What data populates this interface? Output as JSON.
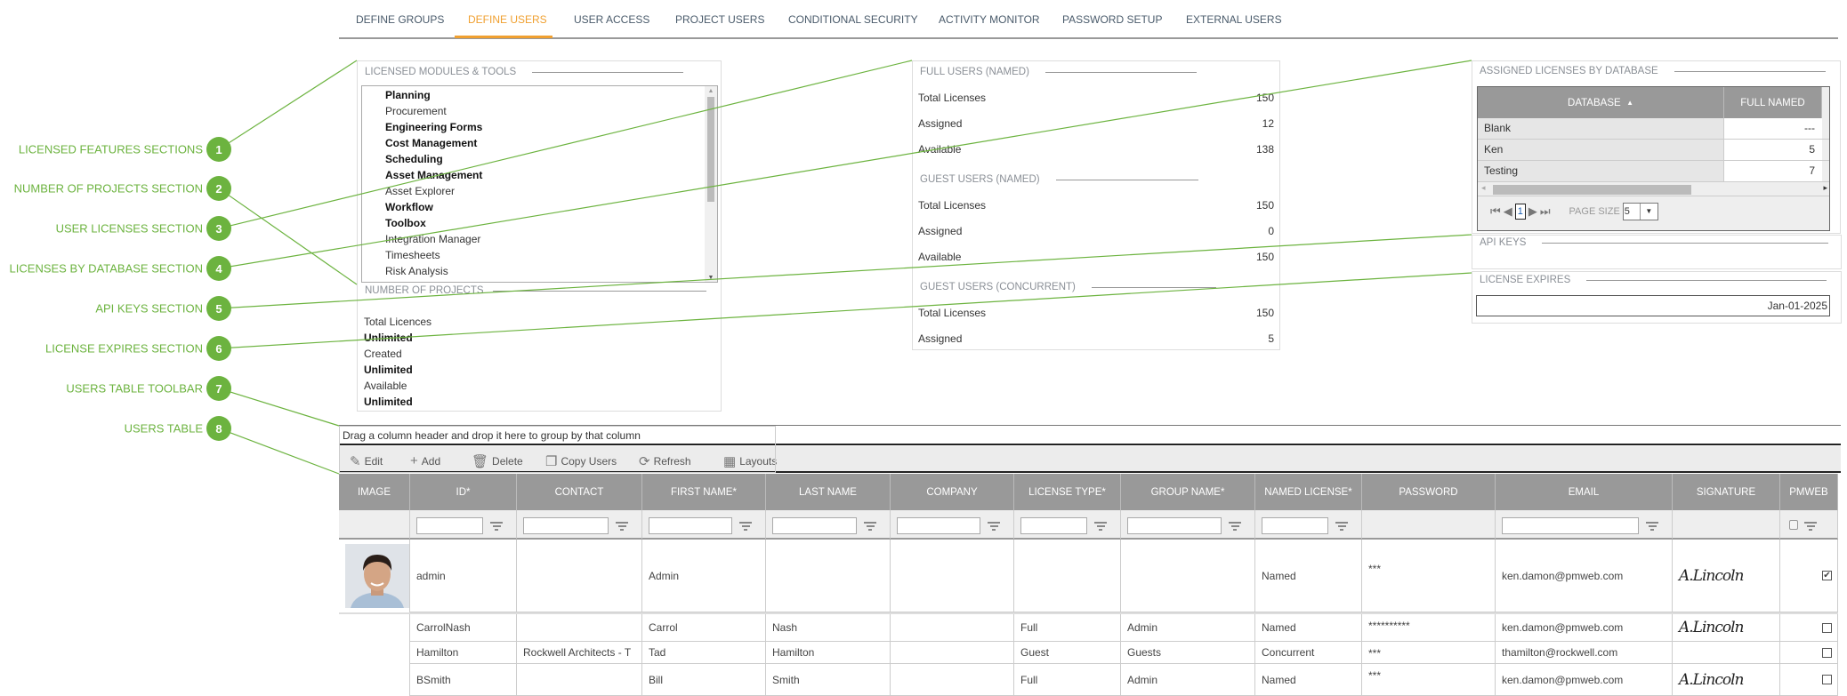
{
  "tabs": [
    {
      "label": "DEFINE GROUPS",
      "active": false
    },
    {
      "label": "DEFINE USERS",
      "active": true
    },
    {
      "label": "USER ACCESS",
      "active": false
    },
    {
      "label": "PROJECT USERS",
      "active": false
    },
    {
      "label": "CONDITIONAL SECURITY",
      "active": false
    },
    {
      "label": "ACTIVITY MONITOR",
      "active": false
    },
    {
      "label": "PASSWORD SETUP",
      "active": false
    },
    {
      "label": "EXTERNAL USERS",
      "active": false
    }
  ],
  "colors": {
    "accent": "#f0a030",
    "annotation": "#6cb33f",
    "header_gray": "#999999"
  },
  "modules": {
    "title": "LICENSED MODULES & TOOLS",
    "items": [
      {
        "label": "Planning",
        "licensed": true
      },
      {
        "label": "Procurement",
        "licensed": false
      },
      {
        "label": "Engineering Forms",
        "licensed": true
      },
      {
        "label": "Cost Management",
        "licensed": true
      },
      {
        "label": "Scheduling",
        "licensed": true
      },
      {
        "label": "Asset Management",
        "licensed": true
      },
      {
        "label": "Asset Explorer",
        "licensed": false
      },
      {
        "label": "Workflow",
        "licensed": true
      },
      {
        "label": "Toolbox",
        "licensed": true
      },
      {
        "label": "Integration Manager",
        "licensed": false
      },
      {
        "label": "Timesheets",
        "licensed": false
      },
      {
        "label": "Risk Analysis",
        "licensed": false
      }
    ]
  },
  "projects": {
    "title": "NUMBER OF PROJECTS",
    "rows": [
      {
        "label": "Total Licences",
        "value": "Unlimited"
      },
      {
        "label": "Created",
        "value": "Unlimited"
      },
      {
        "label": "Available",
        "value": "Unlimited"
      }
    ]
  },
  "licenses": {
    "full_named": {
      "title": "FULL USERS (NAMED)",
      "rows": [
        {
          "label": "Total Licenses",
          "value": "150"
        },
        {
          "label": "Assigned",
          "value": "12"
        },
        {
          "label": "Available",
          "value": "138"
        }
      ]
    },
    "guest_named": {
      "title": "GUEST USERS (NAMED)",
      "rows": [
        {
          "label": "Total Licenses",
          "value": "150"
        },
        {
          "label": "Assigned",
          "value": "0"
        },
        {
          "label": "Available",
          "value": "150"
        }
      ]
    },
    "guest_concurrent": {
      "title": "GUEST USERS (CONCURRENT)",
      "rows": [
        {
          "label": "Total Licenses",
          "value": "150"
        },
        {
          "label": "Assigned",
          "value": "5"
        }
      ]
    }
  },
  "by_database": {
    "title": "ASSIGNED LICENSES BY DATABASE",
    "columns": [
      "DATABASE",
      "FULL NAMED"
    ],
    "sort_icon": "sort-ascending-icon",
    "rows": [
      {
        "database": "Blank",
        "full_named": "---"
      },
      {
        "database": "Ken",
        "full_named": "5"
      },
      {
        "database": "Testing",
        "full_named": "7"
      }
    ],
    "pager": {
      "page": "1",
      "page_size_label": "PAGE SIZE",
      "page_size": "5"
    }
  },
  "api_keys": {
    "title": "API KEYS"
  },
  "license_expires": {
    "title": "LICENSE EXPIRES",
    "value": "Jan-01-2025"
  },
  "users": {
    "group_hint": "Drag a column header and drop it here to group by that column",
    "toolbar": [
      {
        "label": "Edit",
        "icon": "pencil-icon"
      },
      {
        "label": "Add",
        "icon": "plus-icon"
      },
      {
        "label": "Delete",
        "icon": "trash-icon"
      },
      {
        "label": "Copy Users",
        "icon": "copy-icon"
      },
      {
        "label": "Refresh",
        "icon": "refresh-icon"
      },
      {
        "label": "Layouts",
        "icon": "grid-icon"
      }
    ],
    "columns": [
      "IMAGE",
      "ID*",
      "CONTACT",
      "FIRST NAME*",
      "LAST NAME",
      "COMPANY",
      "LICENSE TYPE*",
      "GROUP NAME*",
      "NAMED LICENSE*",
      "PASSWORD",
      "EMAIL",
      "SIGNATURE",
      "PMWEB"
    ],
    "rows": [
      {
        "has_image": true,
        "id": "admin",
        "contact": "",
        "first": "Admin",
        "last": "",
        "company": "",
        "license_type": "",
        "group": "",
        "named": "Named",
        "password": "***",
        "email": "ken.damon@pmweb.com",
        "signature": "A.Lincoln",
        "pmweb": true
      },
      {
        "has_image": false,
        "id": "CarrolNash",
        "contact": "",
        "first": "Carrol",
        "last": "Nash",
        "company": "",
        "license_type": "Full",
        "group": "Admin",
        "named": "Named",
        "password": "**********",
        "email": "ken.damon@pmweb.com",
        "signature": "A.Lincoln",
        "pmweb": false
      },
      {
        "has_image": false,
        "id": "Hamilton",
        "contact": "Rockwell Architects - T",
        "first": "Tad",
        "last": "Hamilton",
        "company": "",
        "license_type": "Guest",
        "group": "Guests",
        "named": "Concurrent",
        "password": "***",
        "email": "thamilton@rockwell.com",
        "signature": "",
        "pmweb": false
      },
      {
        "has_image": false,
        "id": "BSmith",
        "contact": "",
        "first": "Bill",
        "last": "Smith",
        "company": "",
        "license_type": "Full",
        "group": "Admin",
        "named": "Named",
        "password": "***",
        "email": "ken.damon@pmweb.com",
        "signature": "A.Lincoln",
        "pmweb": false
      }
    ]
  },
  "annotations": [
    {
      "num": "1",
      "label": "LICENSED FEATURES SECTIONS"
    },
    {
      "num": "2",
      "label": "NUMBER OF PROJECTS SECTION"
    },
    {
      "num": "3",
      "label": "USER LICENSES SECTION"
    },
    {
      "num": "4",
      "label": "LICENSES BY DATABASE SECTION"
    },
    {
      "num": "5",
      "label": "API KEYS SECTION"
    },
    {
      "num": "6",
      "label": "LICENSE EXPIRES SECTION"
    },
    {
      "num": "7",
      "label": "USERS TABLE TOOLBAR"
    },
    {
      "num": "8",
      "label": "USERS TABLE"
    }
  ]
}
